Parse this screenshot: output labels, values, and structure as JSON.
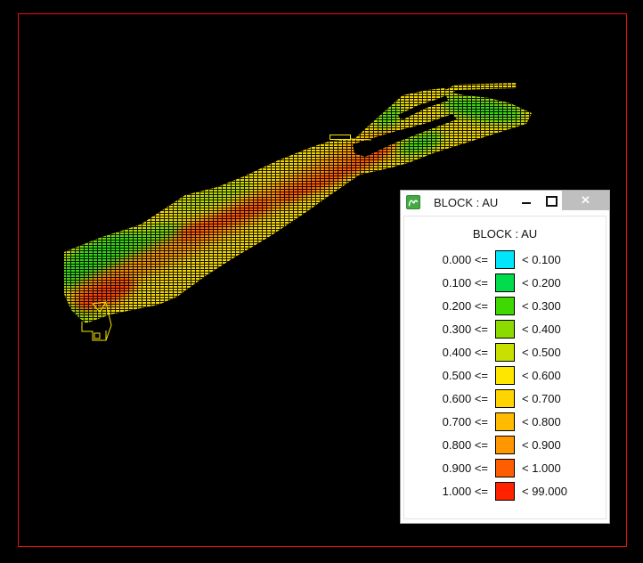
{
  "viewport": {
    "background": "#000000",
    "frame_color": "#EE0E0E",
    "wireframe_color": "#F8E800"
  },
  "window": {
    "title": "BLOCK : AU",
    "icon": "micromine-logo-icon",
    "controls": {
      "minimize": "minimize",
      "maximize": "maximize",
      "close": "close",
      "close_glyph": "✕"
    }
  },
  "legend": {
    "heading": "BLOCK : AU",
    "rows": [
      {
        "min": "0.000 <=",
        "max": "< 0.100",
        "color": "#00E5FA"
      },
      {
        "min": "0.100 <=",
        "max": "< 0.200",
        "color": "#00DC4B"
      },
      {
        "min": "0.200 <=",
        "max": "< 0.300",
        "color": "#3FD800"
      },
      {
        "min": "0.300 <=",
        "max": "< 0.400",
        "color": "#8CDB00"
      },
      {
        "min": "0.400 <=",
        "max": "< 0.500",
        "color": "#C8E000"
      },
      {
        "min": "0.500 <=",
        "max": "< 0.600",
        "color": "#FFE600"
      },
      {
        "min": "0.600 <=",
        "max": "< 0.700",
        "color": "#FFD400"
      },
      {
        "min": "0.700 <=",
        "max": "< 0.800",
        "color": "#FFBB00"
      },
      {
        "min": "0.800 <=",
        "max": "< 0.900",
        "color": "#FF9800"
      },
      {
        "min": "0.900 <=",
        "max": "< 1.000",
        "color": "#FF5E00"
      },
      {
        "min": "1.000 <=",
        "max": "< 99.000",
        "color": "#FF2100"
      }
    ]
  }
}
